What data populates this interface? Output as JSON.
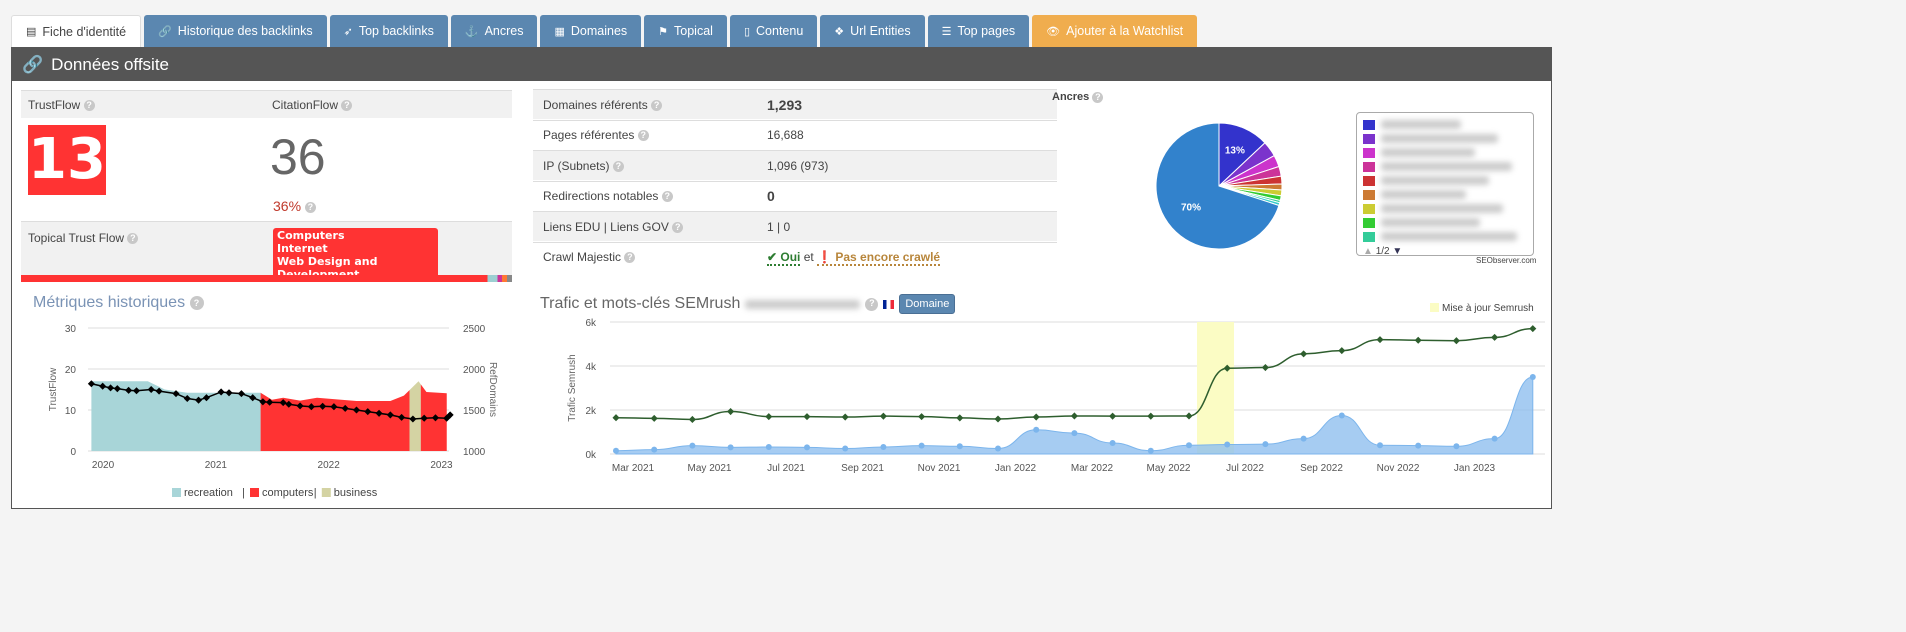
{
  "tabs": [
    {
      "label": "Fiche d'identité",
      "icon": "id-card-icon",
      "active": true
    },
    {
      "label": "Historique des backlinks",
      "icon": "link-icon"
    },
    {
      "label": "Top backlinks",
      "icon": "rocket-icon"
    },
    {
      "label": "Ancres",
      "icon": "anchor-icon"
    },
    {
      "label": "Domaines",
      "icon": "grid-icon"
    },
    {
      "label": "Topical",
      "icon": "flag-icon"
    },
    {
      "label": "Contenu",
      "icon": "file-icon"
    },
    {
      "label": "Url Entities",
      "icon": "cubes-icon"
    },
    {
      "label": "Top pages",
      "icon": "list-icon"
    },
    {
      "label": "Ajouter à la Watchlist",
      "icon": "eye-icon",
      "color": "#f0ad4e"
    }
  ],
  "panel": {
    "title": "Données offsite"
  },
  "flow": {
    "trustflow_label": "TrustFlow",
    "trustflow": "13",
    "citationflow_label": "CitationFlow",
    "citationflow": "36",
    "ratio": "36%",
    "topical_label": "Topical Trust Flow",
    "topics": [
      "Computers",
      "Internet",
      "Web Design and Development"
    ],
    "accent": "#ff3333"
  },
  "metrics": [
    {
      "label": "Domaines référents",
      "value": "1,293"
    },
    {
      "label": "Pages référentes",
      "value": "16,688"
    },
    {
      "label": "IP (Subnets)",
      "value": "1,096 (973)"
    },
    {
      "label": "Redirections notables",
      "value": "0"
    },
    {
      "label": "Liens EDU | Liens GOV",
      "value": "1 | 0"
    },
    {
      "label": "Crawl Majestic",
      "value_ok": "Oui",
      "value_sep": "et",
      "value_warn": "Pas encore crawlé"
    }
  ],
  "anchors": {
    "title": "Ancres",
    "pager": "1/2",
    "credit": "SEObserver.com",
    "chart_data": {
      "type": "pie",
      "values": [
        13,
        4,
        3,
        2.5,
        2,
        1.5,
        1.5,
        1.2,
        0.6,
        0.7,
        70
      ],
      "labels_shown": [
        "13%",
        "",
        "",
        "",
        "",
        "",
        "",
        "",
        "",
        "",
        "70%"
      ],
      "colors": [
        "#3333cc",
        "#7b33cc",
        "#cc33cc",
        "#cc3399",
        "#cc3333",
        "#cc7a33",
        "#cccc33",
        "#33cc33",
        "#33cc99",
        "#33cccc",
        "#3282cc"
      ]
    }
  },
  "historic": {
    "title": "Métriques historiques",
    "chart_data": {
      "type": "area+line",
      "ylabel_left": "TrustFlow",
      "ylabel_right": "RefDomains",
      "ylim_left": [
        0,
        30
      ],
      "ylim_right": [
        1000,
        2500
      ],
      "yticks_left": [
        "0",
        "10",
        "20",
        "30"
      ],
      "yticks_right": [
        "1000",
        "1500",
        "2000",
        "2500"
      ],
      "xticks": [
        "2020",
        "2021",
        "2022",
        "2023"
      ],
      "legend": [
        "recreation",
        "computers",
        "business"
      ],
      "legend_sep": "|",
      "colors": {
        "recreation": "#a8d5d8",
        "computers": "#ff3333",
        "business": "#d4d3a3"
      },
      "trustflow": [
        [
          2019.95,
          17
        ],
        [
          2020.45,
          17
        ],
        [
          2020.6,
          15
        ],
        [
          2020.8,
          14.2
        ],
        [
          2021.45,
          14.2
        ],
        [
          2021.55,
          12.5
        ],
        [
          2021.65,
          13
        ],
        [
          2021.8,
          12.3
        ],
        [
          2021.95,
          13
        ],
        [
          2022.3,
          12.2
        ],
        [
          2022.6,
          12.2
        ],
        [
          2022.72,
          13.5
        ],
        [
          2022.85,
          17
        ],
        [
          2022.92,
          14.4
        ],
        [
          2023.1,
          14.1
        ]
      ],
      "topic_by_x": [
        [
          2019.95,
          "recreation"
        ],
        [
          2021.45,
          "computers"
        ],
        [
          2022.77,
          "business"
        ],
        [
          2022.87,
          "computers"
        ]
      ],
      "refdomains": [
        [
          2019.95,
          1820
        ],
        [
          2020.05,
          1790
        ],
        [
          2020.12,
          1770
        ],
        [
          2020.18,
          1760
        ],
        [
          2020.28,
          1740
        ],
        [
          2020.35,
          1735
        ],
        [
          2020.48,
          1750
        ],
        [
          2020.55,
          1730
        ],
        [
          2020.7,
          1700
        ],
        [
          2020.8,
          1640
        ],
        [
          2020.9,
          1620
        ],
        [
          2020.97,
          1650
        ],
        [
          2021.1,
          1720
        ],
        [
          2021.17,
          1710
        ],
        [
          2021.28,
          1700
        ],
        [
          2021.38,
          1650
        ],
        [
          2021.47,
          1600
        ],
        [
          2021.53,
          1595
        ],
        [
          2021.65,
          1590
        ],
        [
          2021.7,
          1570
        ],
        [
          2021.8,
          1550
        ],
        [
          2021.9,
          1540
        ],
        [
          2022.0,
          1545
        ],
        [
          2022.1,
          1540
        ],
        [
          2022.2,
          1520
        ],
        [
          2022.3,
          1500
        ],
        [
          2022.4,
          1480
        ],
        [
          2022.5,
          1460
        ],
        [
          2022.6,
          1440
        ],
        [
          2022.7,
          1410
        ],
        [
          2022.8,
          1390
        ],
        [
          2022.9,
          1400
        ],
        [
          2023.0,
          1405
        ],
        [
          2023.1,
          1400
        ],
        [
          2023.13,
          1440
        ]
      ]
    }
  },
  "semrush": {
    "title": "Trafic et mots-clés SEMrush",
    "domain_button": "Domaine",
    "legend_update": "Mise à jour Semrush",
    "chart_data": {
      "type": "area+line",
      "ylabel": "Trafic Semrush",
      "ylim": [
        0,
        6000
      ],
      "yticks": [
        "0k",
        "2k",
        "4k",
        "6k"
      ],
      "xticks": [
        "Mar 2021",
        "May 2021",
        "Jul 2021",
        "Sep 2021",
        "Nov 2021",
        "Jan 2022",
        "Mar 2022",
        "May 2022",
        "Jul 2022",
        "Sep 2022",
        "Nov 2022",
        "Jan 2023"
      ],
      "months": [
        "2021-02",
        "2021-03",
        "2021-04",
        "2021-05",
        "2021-06",
        "2021-07",
        "2021-08",
        "2021-09",
        "2021-10",
        "2021-11",
        "2021-12",
        "2022-01",
        "2022-02",
        "2022-03",
        "2022-04",
        "2022-05",
        "2022-06",
        "2022-07",
        "2022-08",
        "2022-09",
        "2022-10",
        "2022-11",
        "2022-12",
        "2023-01",
        "2023-02"
      ],
      "traffic": [
        150,
        200,
        380,
        300,
        320,
        300,
        250,
        320,
        380,
        350,
        250,
        1100,
        950,
        500,
        150,
        400,
        430,
        450,
        700,
        1750,
        400,
        380,
        350,
        700,
        3500
      ],
      "keywords": [
        1650,
        1620,
        1570,
        1930,
        1700,
        1700,
        1680,
        1720,
        1700,
        1640,
        1590,
        1680,
        1730,
        1720,
        1720,
        1730,
        3900,
        3930,
        4550,
        4700,
        5200,
        5170,
        5150,
        5300,
        5700
      ],
      "update_band": [
        "2022-05",
        "2022-06"
      ],
      "colors": {
        "traffic": "#90bfef",
        "keywords": "#2e5e2e",
        "update": "#fbfcc4"
      }
    }
  }
}
